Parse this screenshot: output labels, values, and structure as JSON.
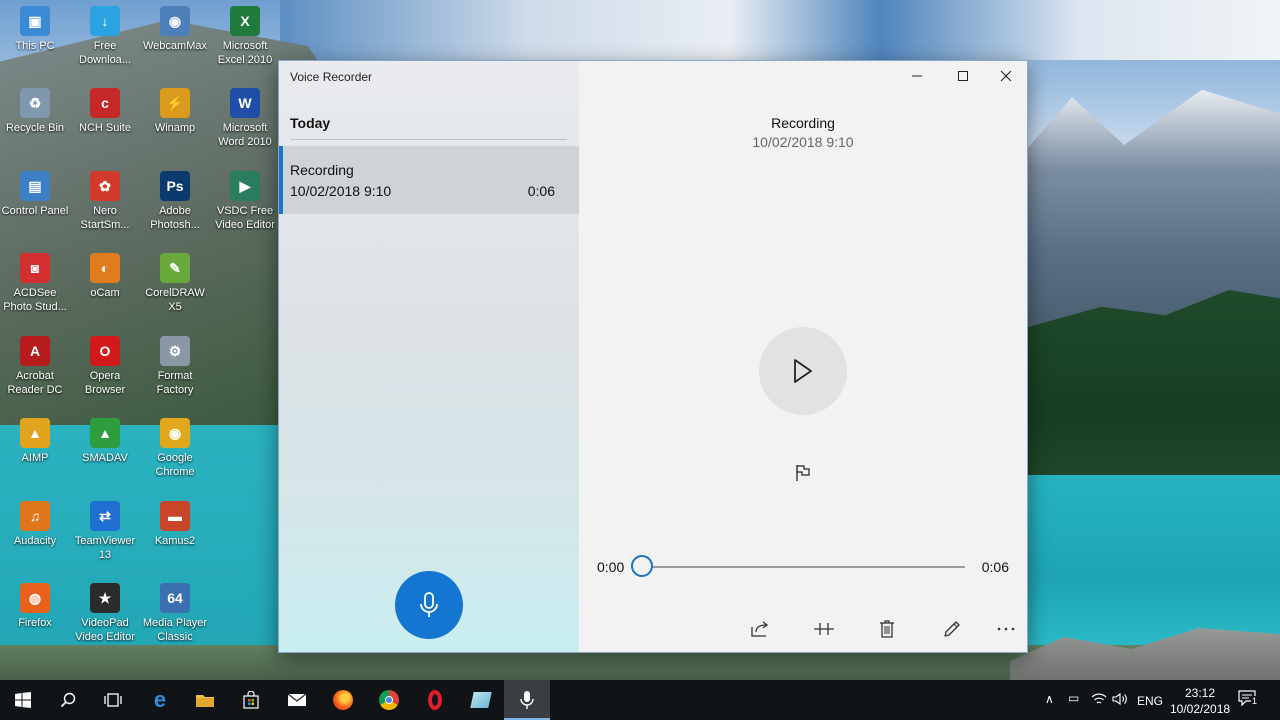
{
  "desktop": {
    "icons": [
      {
        "label": "This PC",
        "glyph": "▣",
        "color": "#3a8ad6"
      },
      {
        "label": "Free Downloa...",
        "glyph": "↓",
        "color": "#2aa3e0"
      },
      {
        "label": "WebcamMax",
        "glyph": "◉",
        "color": "#4d7fb8"
      },
      {
        "label": "Microsoft Excel 2010",
        "glyph": "X",
        "color": "#1f7a3c"
      },
      {
        "label": "Recycle Bin",
        "glyph": "♻",
        "color": "#7f98ad"
      },
      {
        "label": "NCH Suite",
        "glyph": "c",
        "color": "#c62828"
      },
      {
        "label": "Winamp",
        "glyph": "⚡",
        "color": "#d99a1d"
      },
      {
        "label": "Microsoft Word 2010",
        "glyph": "W",
        "color": "#1f4fa6"
      },
      {
        "label": "Control Panel",
        "glyph": "▤",
        "color": "#3c7fc4"
      },
      {
        "label": "Nero StartSm...",
        "glyph": "✿",
        "color": "#d23b2b"
      },
      {
        "label": "Adobe Photosh...",
        "glyph": "Ps",
        "color": "#0b3b6e"
      },
      {
        "label": "VSDC Free Video Editor",
        "glyph": "▶",
        "color": "#2a7d5f"
      },
      {
        "label": "ACDSee Photo Stud...",
        "glyph": "◙",
        "color": "#d32f2f"
      },
      {
        "label": "oCam",
        "glyph": "◐",
        "color": "#e07b1f"
      },
      {
        "label": "CorelDRAW X5",
        "glyph": "✎",
        "color": "#69a83a"
      },
      {
        "label": "",
        "glyph": "",
        "color": ""
      },
      {
        "label": "Acrobat Reader DC",
        "glyph": "A",
        "color": "#b71c1c"
      },
      {
        "label": "Opera Browser",
        "glyph": "O",
        "color": "#d31a1a"
      },
      {
        "label": "Format Factory",
        "glyph": "⚙",
        "color": "#8a97a4"
      },
      {
        "label": "",
        "glyph": "",
        "color": ""
      },
      {
        "label": "AIMP",
        "glyph": "▲",
        "color": "#e3a41d"
      },
      {
        "label": "SMADAV",
        "glyph": "▲",
        "color": "#2e9d3e"
      },
      {
        "label": "Google Chrome",
        "glyph": "◉",
        "color": "#e0a81c"
      },
      {
        "label": "",
        "glyph": "",
        "color": ""
      },
      {
        "label": "Audacity",
        "glyph": "♫",
        "color": "#e0761a"
      },
      {
        "label": "TeamViewer 13",
        "glyph": "⇄",
        "color": "#1f6fd1"
      },
      {
        "label": "Kamus2",
        "glyph": "▬",
        "color": "#c8452a"
      },
      {
        "label": "",
        "glyph": "",
        "color": ""
      },
      {
        "label": "Firefox",
        "glyph": "◍",
        "color": "#e8621c"
      },
      {
        "label": "VideoPad Video Editor",
        "glyph": "★",
        "color": "#2b2b2b"
      },
      {
        "label": "Media Player Classic",
        "glyph": "64",
        "color": "#3a6fb0"
      }
    ]
  },
  "window": {
    "app_title": "Voice Recorder",
    "group_label": "Today",
    "recording": {
      "name": "Recording",
      "date": "10/02/2018 9:10",
      "duration": "0:06"
    },
    "detail": {
      "title": "Recording",
      "subtitle": "10/02/2018 9:10"
    },
    "player": {
      "position": "0:00",
      "length": "0:06",
      "progress": 0.0
    },
    "controls": {
      "minimize": "—",
      "maximize": "☐",
      "close": "✕"
    },
    "accent_color": "#1a73c9"
  },
  "taskbar": {
    "language": "ENG",
    "time": "23:12",
    "date": "10/02/2018",
    "notification_count": "1",
    "overflow": "∧"
  }
}
